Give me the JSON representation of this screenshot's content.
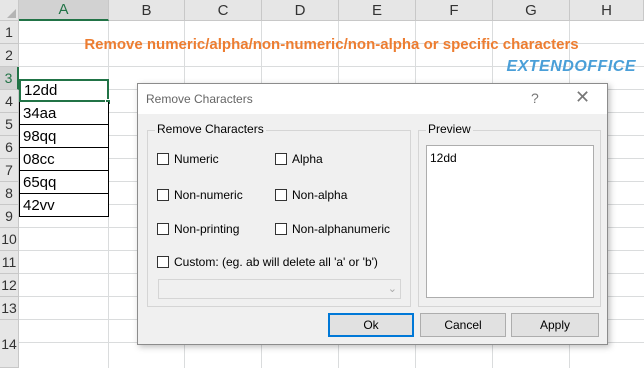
{
  "sheet": {
    "columns": [
      "A",
      "B",
      "C",
      "D",
      "E",
      "F",
      "G",
      "H"
    ],
    "rows": [
      "1",
      "2",
      "3",
      "4",
      "5",
      "6",
      "7",
      "8",
      "9",
      "10",
      "11",
      "12",
      "13",
      "14"
    ],
    "selected_column": "A",
    "selected_row": "3",
    "title": "Remove numeric/alpha/non-numeric/non-alpha or specific characters",
    "logo": "EXTENDOFFICE",
    "cells": [
      "12dd",
      "34aa",
      "98qq",
      "08cc",
      "65qq",
      "42vv"
    ],
    "colors": {
      "title": "#ed7d31",
      "logo": "#4a9fd8",
      "selection": "#217346"
    }
  },
  "dialog": {
    "title": "Remove Characters",
    "help": "?",
    "close": "✕",
    "group_label": "Remove Characters",
    "options": {
      "numeric": "Numeric",
      "alpha": "Alpha",
      "non_numeric": "Non-numeric",
      "non_alpha": "Non-alpha",
      "non_printing": "Non-printing",
      "non_alphanumeric": "Non-alphanumeric",
      "custom": "Custom:  (eg. ab will delete all 'a' or 'b')"
    },
    "custom_value": "",
    "preview_label": "Preview",
    "preview_text": "12dd",
    "buttons": {
      "ok": "Ok",
      "cancel": "Cancel",
      "apply": "Apply"
    }
  }
}
